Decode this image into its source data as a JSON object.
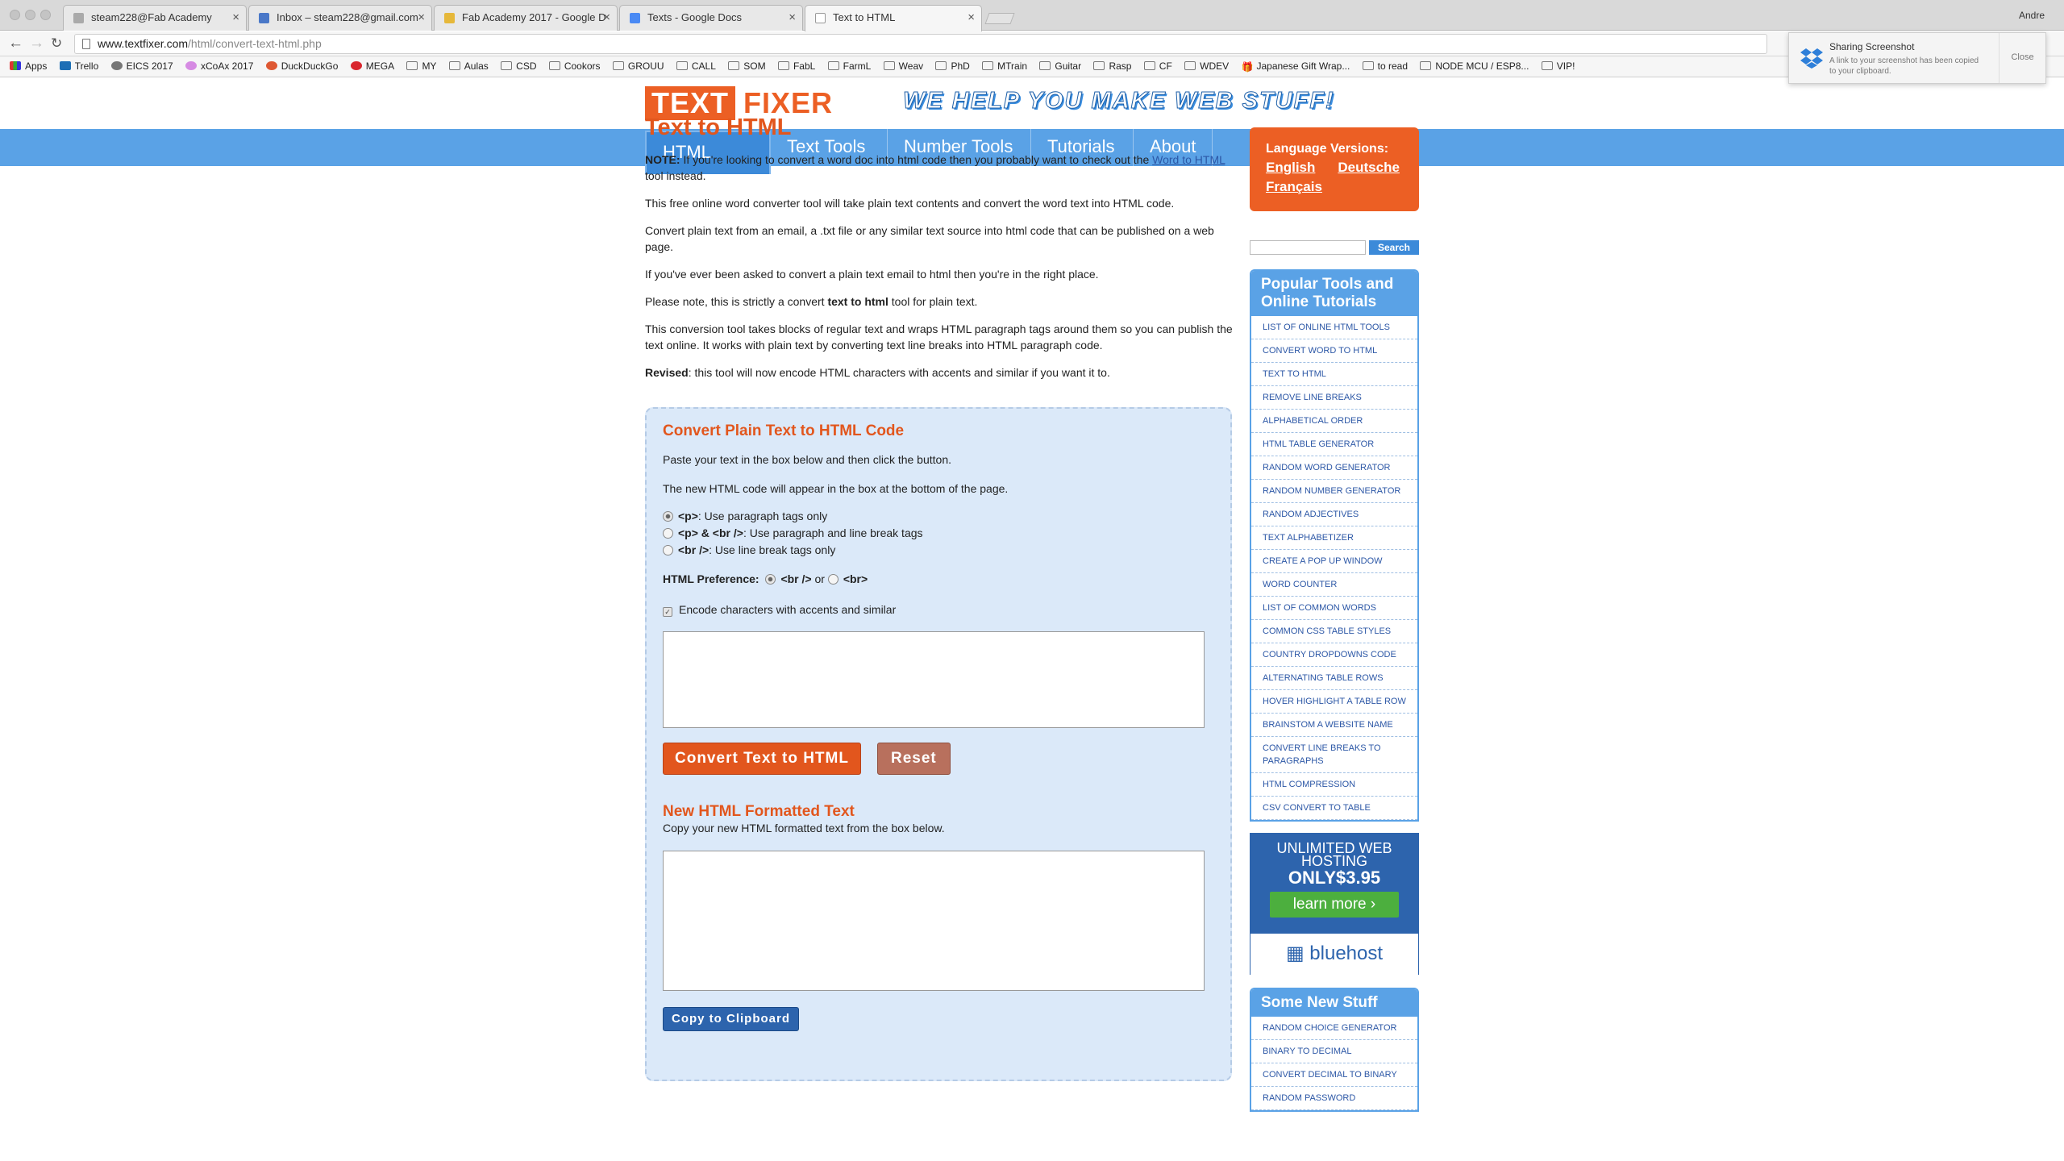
{
  "browser": {
    "tabs": [
      {
        "label": "steam228@Fab Academy",
        "icon_color": "#aaaaaa"
      },
      {
        "label": "Inbox – steam228@gmail.com",
        "icon_color": "#4a78c8"
      },
      {
        "label": "Fab Academy 2017 - Google D",
        "icon_color": "#e6b83a"
      },
      {
        "label": "Texts - Google Docs",
        "icon_color": "#4a8af4"
      },
      {
        "label": "Text to HTML",
        "icon_color": "#bbbbbb"
      }
    ],
    "user": "Andre",
    "url_host": "www.textfixer.com",
    "url_path": "/html/convert-text-html.php",
    "bookmarks": [
      "Apps",
      "Trello",
      "EICS 2017",
      "xCoAx 2017",
      "DuckDuckGo",
      "MEGA",
      "MY",
      "Aulas",
      "CSD",
      "Cookors",
      "GROUU",
      "CALL",
      "SOM",
      "FabL",
      "FarmL",
      "Weav",
      "PhD",
      "MTrain",
      "Guitar",
      "Rasp",
      "CF",
      "WDEV",
      "Japanese Gift Wrap...",
      "to read",
      "NODE MCU / ESP8...",
      "VIP!"
    ]
  },
  "notification": {
    "title": "Sharing Screenshot",
    "message": "A link to your screenshot has been copied to your clipboard.",
    "close": "Close"
  },
  "header": {
    "logo_part1": "TEXT",
    "logo_part2": "FIXER",
    "slogan": "WE HELP YOU MAKE WEB STUFF!"
  },
  "nav": [
    "HTML Tools",
    "Text Tools",
    "Number Tools",
    "Tutorials",
    "About"
  ],
  "main": {
    "title": "Text to HTML",
    "note_label": "NOTE:",
    "note_text": " If you're looking to convert a word doc into html code then you probably want to check out the ",
    "note_link": "Word to HTML",
    "note_after": " tool instead.",
    "p1": "This free online word converter tool will take plain text contents and convert the word text into HTML code.",
    "p2": "Convert plain text from an email, a .txt file or any similar text source into html code that can be published on a web page.",
    "p3": "If you've ever been asked to convert a plain text email to html then you're in the right place.",
    "p4_before": "Please note, this is strictly a convert ",
    "p4_bold": "text to html",
    "p4_after": " tool for plain text.",
    "p5": "This conversion tool takes blocks of regular text and wraps HTML paragraph tags around them so you can publish the text online. It works with plain text by converting text line breaks into HTML paragraph code.",
    "revised_label": "Revised",
    "revised_text": ": this tool will now encode HTML characters with accents and similar if you want it to."
  },
  "converter": {
    "heading": "Convert Plain Text to HTML Code",
    "instr1": "Paste your text in the box below and then click the button.",
    "instr2": "The new HTML code will appear in the box at the bottom of the page.",
    "opt1_tag": "<p>",
    "opt1_text": ": Use paragraph tags only",
    "opt2_tag": "<p> & <br />",
    "opt2_text": ": Use paragraph and line break tags",
    "opt3_tag": "<br />",
    "opt3_text": ": Use line break tags only",
    "pref_label": "HTML Preference:",
    "pref_opt1": "<br />",
    "pref_or": " or ",
    "pref_opt2": "<br>",
    "encode_label": "Encode characters with accents and similar",
    "input_value": "",
    "convert_button": "Convert Text to HTML",
    "reset_button": "Reset",
    "output_heading": "New HTML Formatted Text",
    "output_instr": "Copy your new HTML formatted text from the box below.",
    "output_value": "",
    "copy_button": "Copy to Clipboard"
  },
  "sidebar": {
    "lang_title": "Language Versions:",
    "lang_links": [
      "English",
      "Deutsche",
      "Français"
    ],
    "search_value": "",
    "search_button": "Search",
    "popular_title": "Popular Tools and Online Tutorials",
    "popular": [
      "List of Online HTML Tools",
      "Convert Word to HTML",
      "Text to HTML",
      "Remove Line Breaks",
      "Alphabetical Order",
      "HTML Table Generator",
      "Random Word Generator",
      "Random Number Generator",
      "Random Adjectives",
      "Text Alphabetizer",
      "Create a Pop Up Window",
      "Word Counter",
      "List of Common Words",
      "Common CSS Table Styles",
      "Country Dropdowns Code",
      "Alternating Table Rows",
      "Hover Highlight a Table Row",
      "Brainstom a Website Name",
      "Convert Line Breaks to Paragraphs",
      "HTML Compression",
      "CSV Convert to Table"
    ],
    "ad_line1": "UNLIMITED WEB HOSTING",
    "ad_line2": "ONLY$3.95",
    "ad_button": "learn more",
    "ad_brand": "bluehost",
    "new_title": "Some New Stuff",
    "new_items": [
      "Random Choice Generator",
      "Binary to Decimal",
      "Convert Decimal to Binary",
      "Random Password"
    ]
  },
  "colors": {
    "brand_orange": "#ec5f24",
    "nav_blue": "#5aa2e6",
    "panel_blue": "#dbe9f9"
  }
}
